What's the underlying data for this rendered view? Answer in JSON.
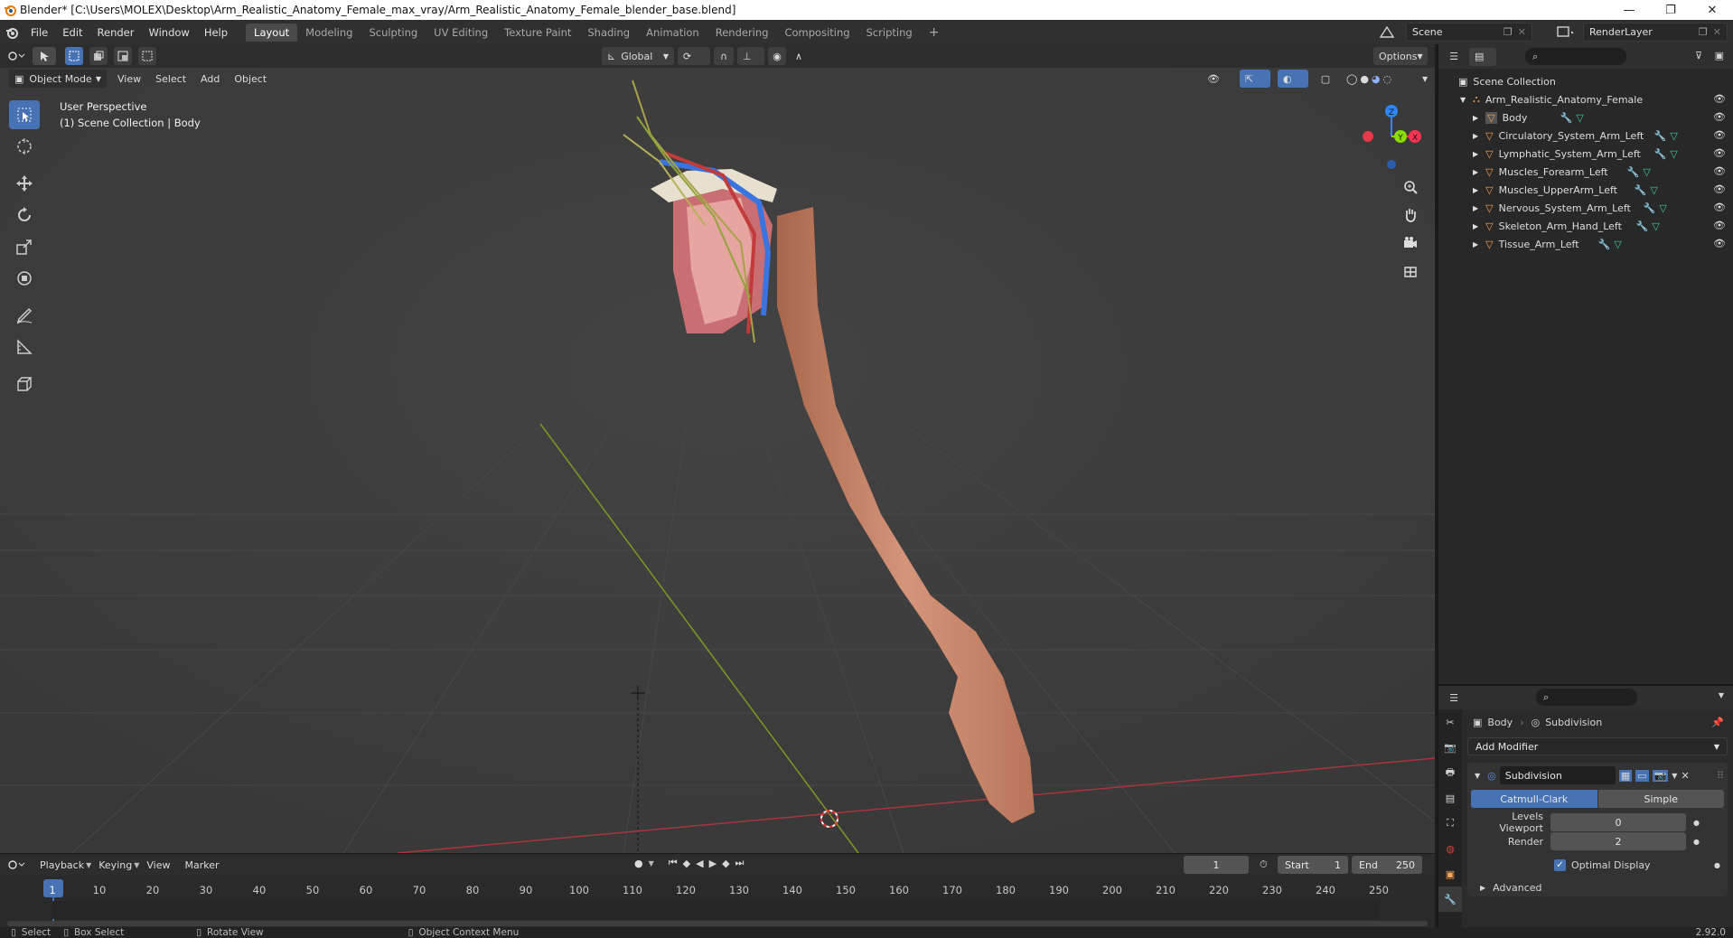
{
  "window": {
    "title": "Blender* [C:\\Users\\MOLEX\\Desktop\\Arm_Realistic_Anatomy_Female_max_vray/Arm_Realistic_Anatomy_Female_blender_base.blend]",
    "minimize": "—",
    "maximize": "❐",
    "close": "✕"
  },
  "menu": [
    "File",
    "Edit",
    "Render",
    "Window",
    "Help"
  ],
  "workspaces": [
    "Layout",
    "Modeling",
    "Sculpting",
    "UV Editing",
    "Texture Paint",
    "Shading",
    "Animation",
    "Rendering",
    "Compositing",
    "Scripting"
  ],
  "active_workspace": "Layout",
  "add_workspace": "+",
  "scene": {
    "name": "Scene",
    "view_layer": "RenderLayer"
  },
  "viewport": {
    "transform_orientation": "Global",
    "options_label": "Options",
    "mode": "Object Mode",
    "header_menus": [
      "View",
      "Select",
      "Add",
      "Object"
    ],
    "info_line1": "User Perspective",
    "info_line2": "(1) Scene Collection | Body",
    "gizmo_z": "Z",
    "gizmo_y": "Y",
    "gizmo_x": "X"
  },
  "outliner": {
    "root": "Scene Collection",
    "collection": "Arm_Realistic_Anatomy_Female",
    "objects": [
      "Body",
      "Circulatory_System_Arm_Left",
      "Lymphatic_System_Arm_Left",
      "Muscles_Forearm_Left",
      "Muscles_UpperArm_Left",
      "Nervous_System_Arm_Left",
      "Skeleton_Arm_Hand_Left",
      "Tissue_Arm_Left"
    ]
  },
  "properties": {
    "object_name": "Body",
    "modifier_breadcrumb": "Subdivision",
    "add_modifier": "Add Modifier",
    "modifier_name": "Subdivision",
    "method_catmull": "Catmull-Clark",
    "method_simple": "Simple",
    "levels_viewport_label": "Levels Viewport",
    "levels_viewport_value": "0",
    "render_label": "Render",
    "render_value": "2",
    "optimal_display": "Optimal Display",
    "advanced": "Advanced"
  },
  "timeline": {
    "menus": [
      "Playback",
      "Keying",
      "View",
      "Marker"
    ],
    "current_frame": "1",
    "start_label": "Start",
    "start_value": "1",
    "end_label": "End",
    "end_value": "250",
    "ruler": [
      "1",
      "10",
      "20",
      "30",
      "40",
      "50",
      "60",
      "70",
      "80",
      "90",
      "100",
      "110",
      "120",
      "130",
      "140",
      "150",
      "160",
      "170",
      "180",
      "190",
      "200",
      "210",
      "220",
      "230",
      "240",
      "250"
    ]
  },
  "status": {
    "select": "Select",
    "box_select": "Box Select",
    "rotate_view": "Rotate View",
    "context_menu": "Object Context Menu",
    "version": "2.92.0"
  },
  "colors": {
    "accent": "#4772b3",
    "object_icon": "#f5a45b",
    "modifier_icon": "#5b8fde",
    "mesh_icon": "#43c9a7",
    "axis_x": "#ff3352",
    "axis_y": "#8bdc00",
    "axis_z": "#2f87ff"
  }
}
